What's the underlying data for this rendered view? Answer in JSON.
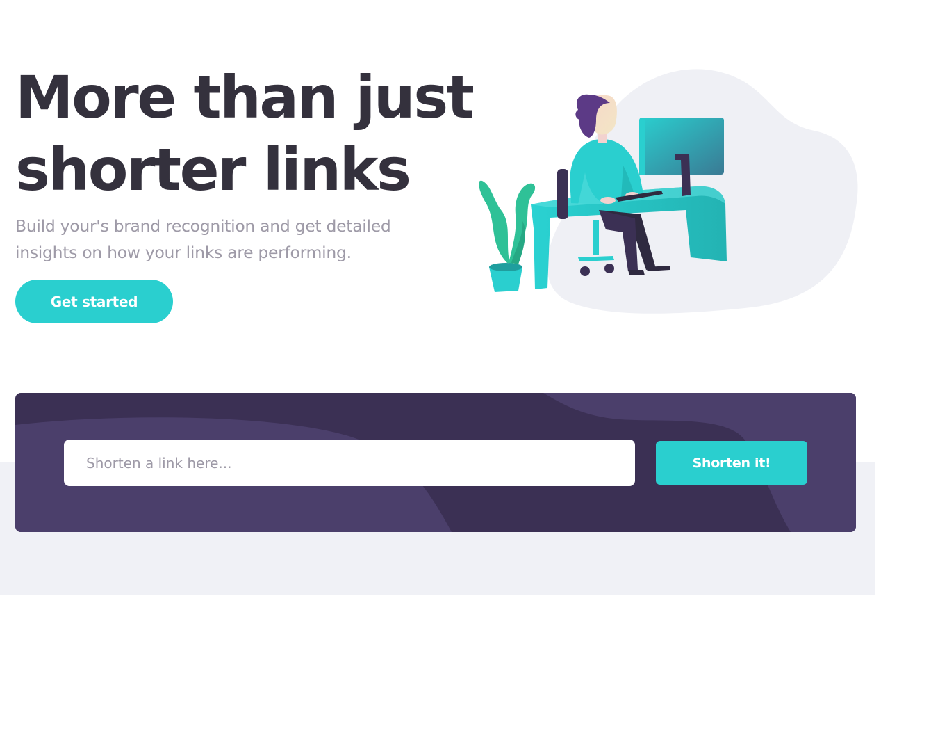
{
  "hero": {
    "title_line1": "More than just",
    "title_line2": "shorter links",
    "subtitle": "Build your's brand recognition and get detailed insights on how your links are performing.",
    "cta_label": "Get started",
    "illustration": "person-working-at-desk-illustration"
  },
  "shorten": {
    "placeholder": "Shorten a link here...",
    "value": "",
    "button_label": "Shorten it!"
  },
  "colors": {
    "primary_cyan": "#2acfcf",
    "dark_violet": "#3b3054",
    "violet_light": "#4b3f6b",
    "heading": "#34313d",
    "body_text": "#9e9aa7",
    "light_grey_bg": "#f0f1f6"
  }
}
